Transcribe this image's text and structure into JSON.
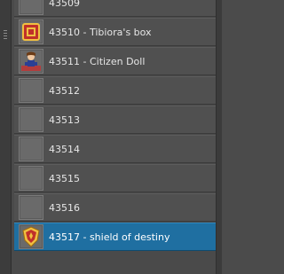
{
  "items": [
    {
      "label": "43509",
      "icon": "empty-thumbnail"
    },
    {
      "label": "43510 - Tibiora's box",
      "icon": "red-box-icon"
    },
    {
      "label": "43511 - Citizen Doll",
      "icon": "citizen-doll-icon"
    },
    {
      "label": "43512",
      "icon": "empty-thumbnail"
    },
    {
      "label": "43513",
      "icon": "empty-thumbnail"
    },
    {
      "label": "43514",
      "icon": "empty-thumbnail"
    },
    {
      "label": "43515",
      "icon": "empty-thumbnail"
    },
    {
      "label": "43516",
      "icon": "empty-thumbnail"
    },
    {
      "label": "43517 - shield of destiny",
      "icon": "shield-icon",
      "selected": true
    }
  ],
  "colors": {
    "background": "#4a4a4a",
    "row": "#505050",
    "selected": "#1f6fa1",
    "text": "#e6e6e6"
  }
}
